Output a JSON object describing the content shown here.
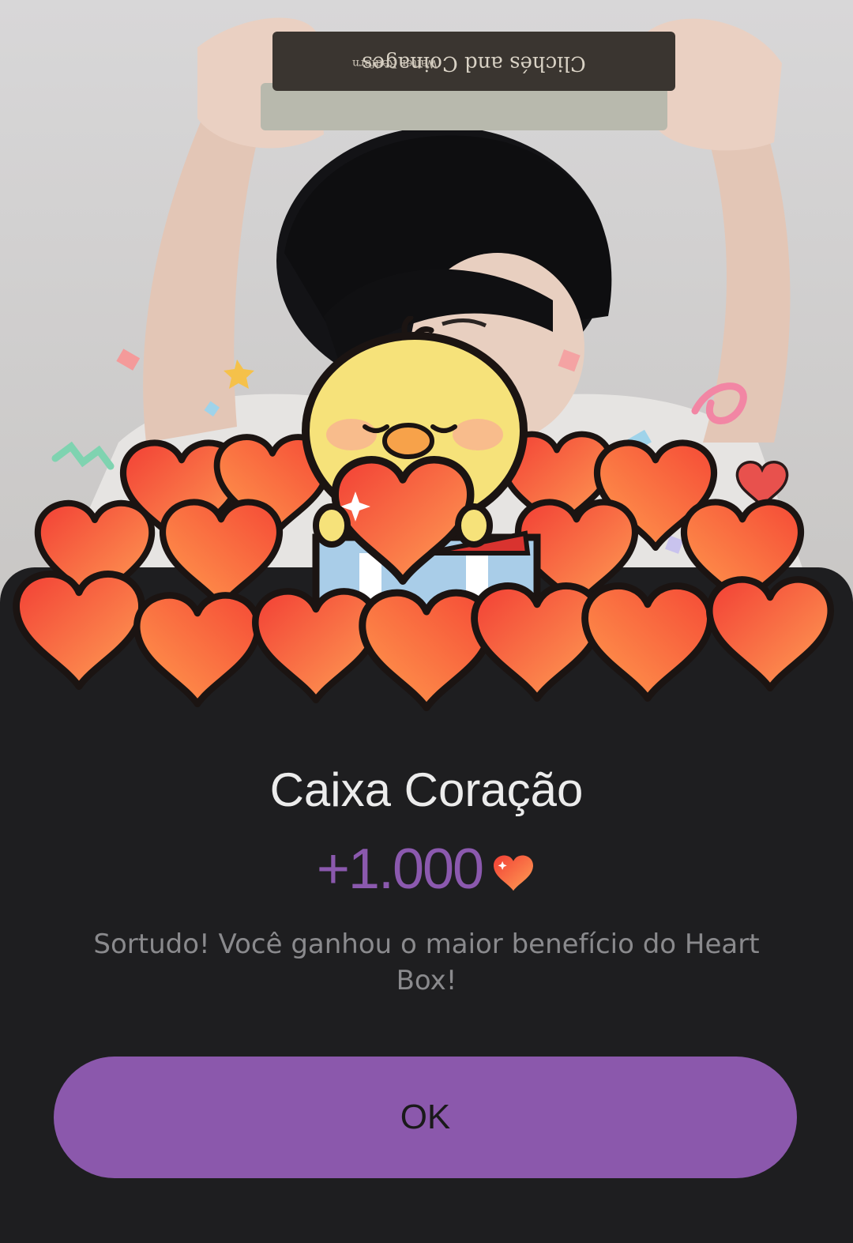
{
  "dialog": {
    "title": "Caixa Coração",
    "reward_amount": "+1.000",
    "reward_icon": "heart-icon",
    "message": "Sortudo! Você ganhou o maior benefício do Heart Box!",
    "ok_label": "OK"
  },
  "background_photo": {
    "book_spine_title": "Clichés and Coinages",
    "book_spine_author": "Walter Redfern"
  },
  "colors": {
    "accent_purple": "#8b58ac",
    "sheet_background": "#1e1e20",
    "heart_red": "#f25a3c",
    "heart_orange": "#ff9a4a",
    "chick_yellow": "#f6e27a"
  }
}
